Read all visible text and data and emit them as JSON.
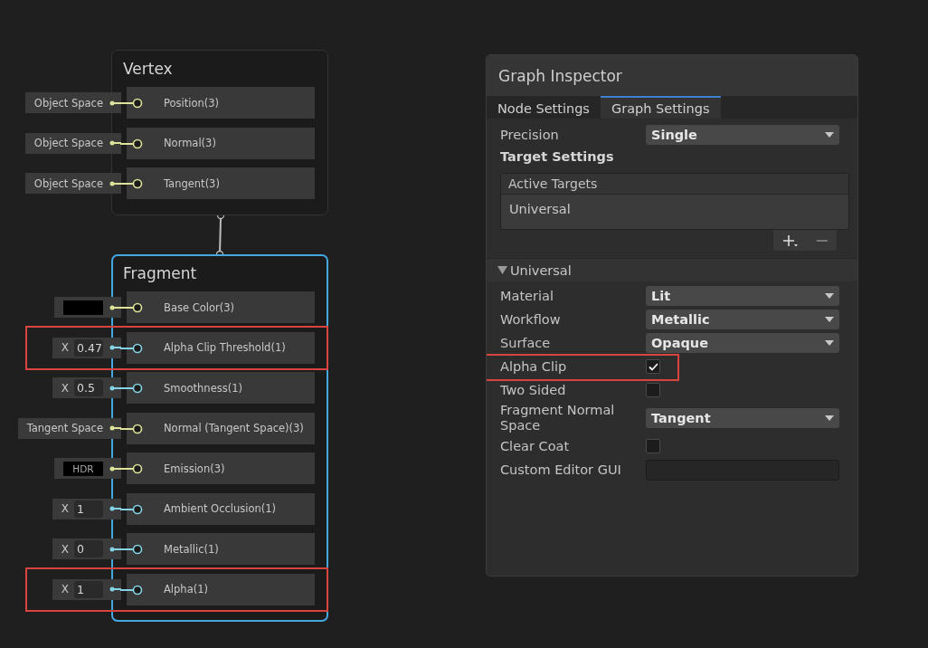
{
  "nodes": [
    {
      "title": "Vertex",
      "selected": false,
      "ports": [
        {
          "kind": "space",
          "input": "Object Space",
          "label": "Position(3)",
          "color": "#dfe39a",
          "highlighted": false
        },
        {
          "kind": "space",
          "input": "Object Space",
          "label": "Normal(3)",
          "color": "#dfe39a",
          "highlighted": false
        },
        {
          "kind": "space",
          "input": "Object Space",
          "label": "Tangent(3)",
          "color": "#dfe39a",
          "highlighted": false
        }
      ]
    },
    {
      "title": "Fragment",
      "selected": true,
      "ports": [
        {
          "kind": "swatch",
          "label": "Base Color(3)",
          "color": "#dfe39a",
          "highlighted": false
        },
        {
          "kind": "float",
          "axis": "X",
          "value": "0.47",
          "label": "Alpha Clip Threshold(1)",
          "color": "#84d4e6",
          "highlighted": true
        },
        {
          "kind": "float",
          "axis": "X",
          "value": "0.5",
          "label": "Smoothness(1)",
          "color": "#84d4e6",
          "highlighted": false
        },
        {
          "kind": "space",
          "input": "Tangent Space",
          "label": "Normal (Tangent Space)(3)",
          "color": "#dfe39a",
          "highlighted": false
        },
        {
          "kind": "hdr",
          "input": "HDR",
          "label": "Emission(3)",
          "color": "#dfe39a",
          "highlighted": false
        },
        {
          "kind": "float",
          "axis": "X",
          "value": "1",
          "label": "Ambient Occlusion(1)",
          "color": "#84d4e6",
          "highlighted": false
        },
        {
          "kind": "float",
          "axis": "X",
          "value": "0",
          "label": "Metallic(1)",
          "color": "#84d4e6",
          "highlighted": false
        },
        {
          "kind": "float",
          "axis": "X",
          "value": "1",
          "label": "Alpha(1)",
          "color": "#84d4e6",
          "highlighted": true
        }
      ]
    }
  ],
  "inspector": {
    "title": "Graph Inspector",
    "tabs": [
      {
        "label": "Node Settings",
        "selected": false
      },
      {
        "label": "Graph Settings",
        "selected": true
      }
    ],
    "precision": {
      "label": "Precision",
      "value": "Single"
    },
    "target_settings": "Target Settings",
    "active_targets": {
      "header": "Active Targets",
      "items": [
        "Universal"
      ]
    },
    "section": {
      "label": "Universal",
      "expanded": true
    },
    "properties": [
      {
        "kind": "dropdown",
        "label": "Material",
        "value": "Lit",
        "highlighted": false
      },
      {
        "kind": "dropdown",
        "label": "Workflow",
        "value": "Metallic",
        "highlighted": false
      },
      {
        "kind": "dropdown",
        "label": "Surface",
        "value": "Opaque",
        "highlighted": false
      },
      {
        "kind": "checkbox",
        "label": "Alpha Clip",
        "checked": true,
        "highlighted": true
      },
      {
        "kind": "checkbox",
        "label": "Two Sided",
        "checked": false,
        "highlighted": false
      },
      {
        "kind": "dropdown",
        "label": "Fragment Normal Space",
        "value": "Tangent",
        "highlighted": false
      },
      {
        "kind": "checkbox",
        "label": "Clear Coat",
        "checked": false,
        "highlighted": false
      },
      {
        "kind": "text",
        "label": "Custom Editor GUI",
        "highlighted": false
      }
    ]
  }
}
